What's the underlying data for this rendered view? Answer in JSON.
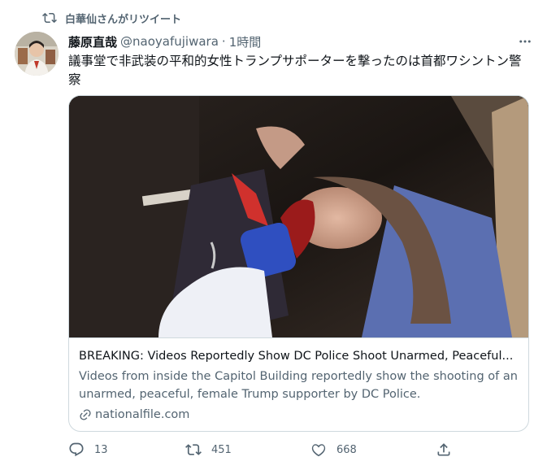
{
  "retweet": {
    "text": "白華仙さんがリツイート",
    "icon": "retweet-icon"
  },
  "tweet": {
    "display_name": "藤原直哉",
    "handle": "@naoyafujiwara",
    "separator": "·",
    "time": "1時間",
    "more_icon": "more-icon",
    "text": "議事堂で非武装の平和的女性トランプサポーターを撃ったのは首都ワシントン警察"
  },
  "card": {
    "title": "BREAKING: Videos Reportedly Show DC Police Shoot Unarmed, Peaceful...",
    "description": "Videos from inside the Capitol Building reportedly show the shooting of an unarmed, peaceful, female Trump supporter by DC Police.",
    "domain": "nationalfile.com"
  },
  "actions": {
    "reply_count": "13",
    "retweet_count": "451",
    "like_count": "668"
  },
  "colors": {
    "text": "#0f1419",
    "secondary": "#536471",
    "border": "#cfd9de"
  }
}
